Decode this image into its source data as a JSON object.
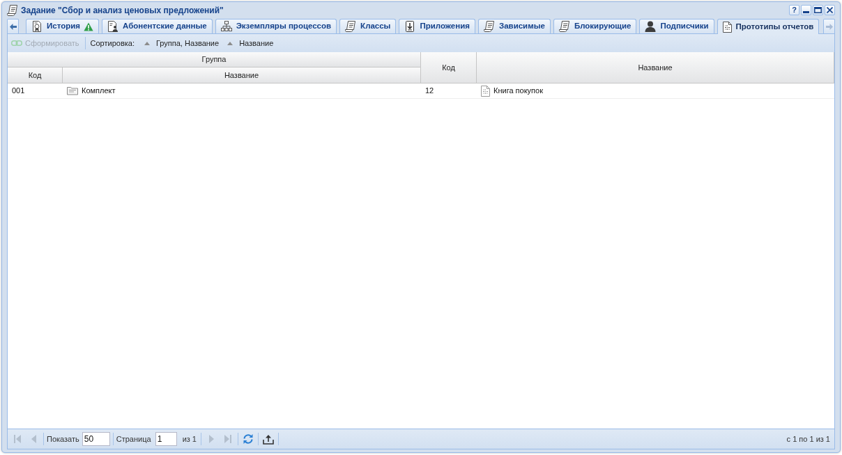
{
  "window": {
    "title": "Задание \"Сбор и анализ ценовых предложений\""
  },
  "tool_buttons": [
    {
      "kind": "help",
      "label": "?"
    },
    {
      "kind": "minimize"
    },
    {
      "kind": "maximize"
    },
    {
      "kind": "close"
    }
  ],
  "tab_scroll": {
    "left_disabled": false,
    "right_disabled": true
  },
  "tabs": [
    {
      "label": "История",
      "kind": "seal",
      "warning": true,
      "selected": false
    },
    {
      "label": "Абонентские данные",
      "kind": "card",
      "warning": false,
      "selected": false
    },
    {
      "label": "Экземпляры процессов",
      "kind": "hierarchy",
      "warning": false,
      "selected": false
    },
    {
      "label": "Классы",
      "kind": "scroll",
      "warning": false,
      "selected": false
    },
    {
      "label": "Приложения",
      "kind": "download",
      "warning": false,
      "selected": false
    },
    {
      "label": "Зависимые",
      "kind": "scroll",
      "warning": false,
      "selected": false
    },
    {
      "label": "Блокирующие",
      "kind": "scroll",
      "warning": false,
      "selected": false
    },
    {
      "label": "Подписчики",
      "kind": "person",
      "warning": false,
      "selected": false
    },
    {
      "label": "Прототипы отчетов",
      "kind": "report",
      "warning": false,
      "selected": true
    }
  ],
  "toolbar": {
    "generate_button": {
      "label": "Сформировать",
      "disabled": true
    },
    "sort_label": "Сортировка:",
    "sort_buttons": [
      {
        "label": "Группа, Название",
        "ascending": true
      },
      {
        "label": "Название",
        "ascending": true
      }
    ]
  },
  "table": {
    "column_group": {
      "label": "Группа"
    },
    "columns": [
      {
        "label": "Код",
        "in_group": true
      },
      {
        "label": "Название",
        "in_group": true
      },
      {
        "label": "Код",
        "in_group": false
      },
      {
        "label": "Название",
        "in_group": false
      }
    ],
    "rows": [
      {
        "cells": [
          {
            "text": "001"
          },
          {
            "text": "Комплект",
            "kind": "folder"
          },
          {
            "text": "12"
          },
          {
            "text": "Книга покупок",
            "kind": "report"
          }
        ]
      }
    ]
  },
  "pager": {
    "nav_back": [
      {
        "kind": "first",
        "disabled": true
      },
      {
        "kind": "prev",
        "disabled": true
      }
    ],
    "page_size": {
      "label": "Показать",
      "value": "50"
    },
    "page": {
      "label": "Страница",
      "value": "1",
      "total": "из 1"
    },
    "nav_forward": [
      {
        "kind": "next",
        "disabled": true
      },
      {
        "kind": "last",
        "disabled": true
      }
    ],
    "display_info": "с 1 по 1 из 1"
  }
}
